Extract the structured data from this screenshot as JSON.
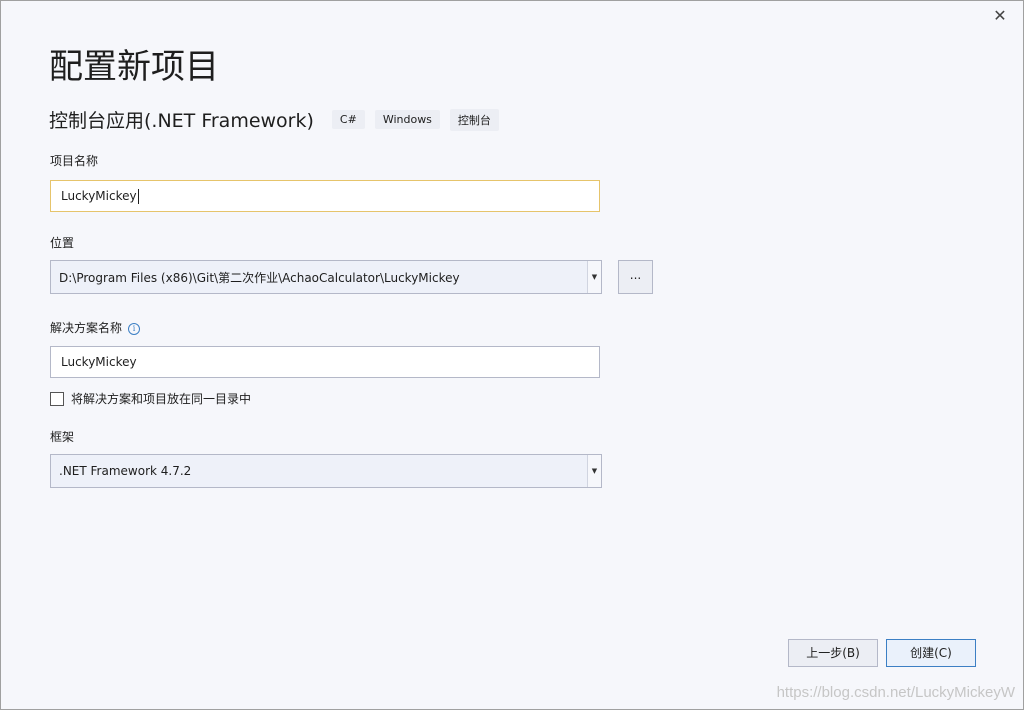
{
  "window": {
    "close_glyph": "✕"
  },
  "header": {
    "title": "配置新项目",
    "subtitle": "控制台应用(.NET Framework)",
    "tags": [
      "C#",
      "Windows",
      "控制台"
    ]
  },
  "form": {
    "project_name": {
      "label": "项目名称",
      "value": "LuckyMickey"
    },
    "location": {
      "label": "位置",
      "value": "D:\\Program Files (x86)\\Git\\第二次作业\\AchaoCalculator\\LuckyMickey",
      "browse_label": "..."
    },
    "solution_name": {
      "label": "解决方案名称",
      "info_glyph": "i",
      "value": "LuckyMickey"
    },
    "same_dir": {
      "label": "将解决方案和项目放在同一目录中",
      "checked": false
    },
    "framework": {
      "label": "框架",
      "value": ".NET Framework 4.7.2"
    }
  },
  "footer": {
    "back_label": "上一步(B)",
    "create_label": "创建(C)"
  },
  "watermark": "https://blog.csdn.net/LuckyMickeyW",
  "colors": {
    "background": "#f6f7fb",
    "focus_border": "#e6c46b",
    "accent": "#3c7fc4"
  }
}
